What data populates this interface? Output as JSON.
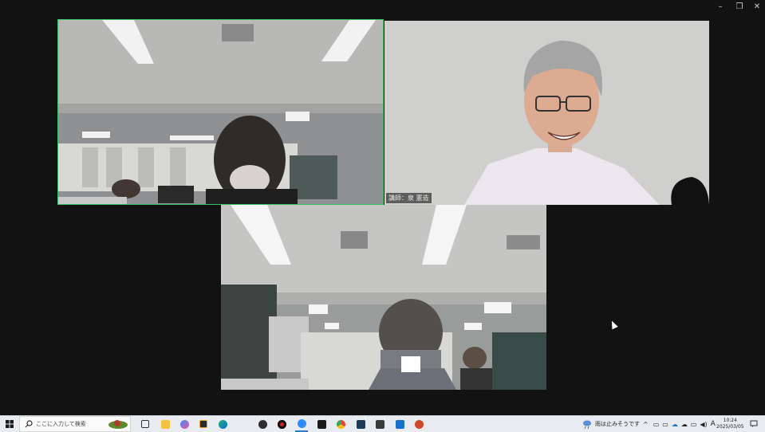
{
  "window_controls": {
    "minimize": "–",
    "restore": "❐",
    "close": "✕"
  },
  "participants": [
    {
      "name": ""
    },
    {
      "name": "講師：泉 憲造"
    },
    {
      "name": ""
    }
  ],
  "taskbar": {
    "start_icon": "windows-logo-icon",
    "search_placeholder": "ここに入力して検索",
    "pinned_apps": [
      "task-view-icon",
      "file-explorer-icon",
      "copilot-icon",
      "app-orange-icon",
      "edge-icon",
      "app-dark-icon",
      "record-icon",
      "zoom-icon",
      "app-black-icon",
      "chrome-icon",
      "app-blue-icon",
      "app-grid-icon",
      "outlook-icon",
      "powerpoint-icon"
    ],
    "weather_text": "雨は止みそうです",
    "time": "10:24",
    "date": "2025/03/05",
    "ime": "A"
  },
  "colors": {
    "active_speaker": "#37c06a",
    "background": "#121212",
    "taskbar": "#e8ebf0"
  }
}
